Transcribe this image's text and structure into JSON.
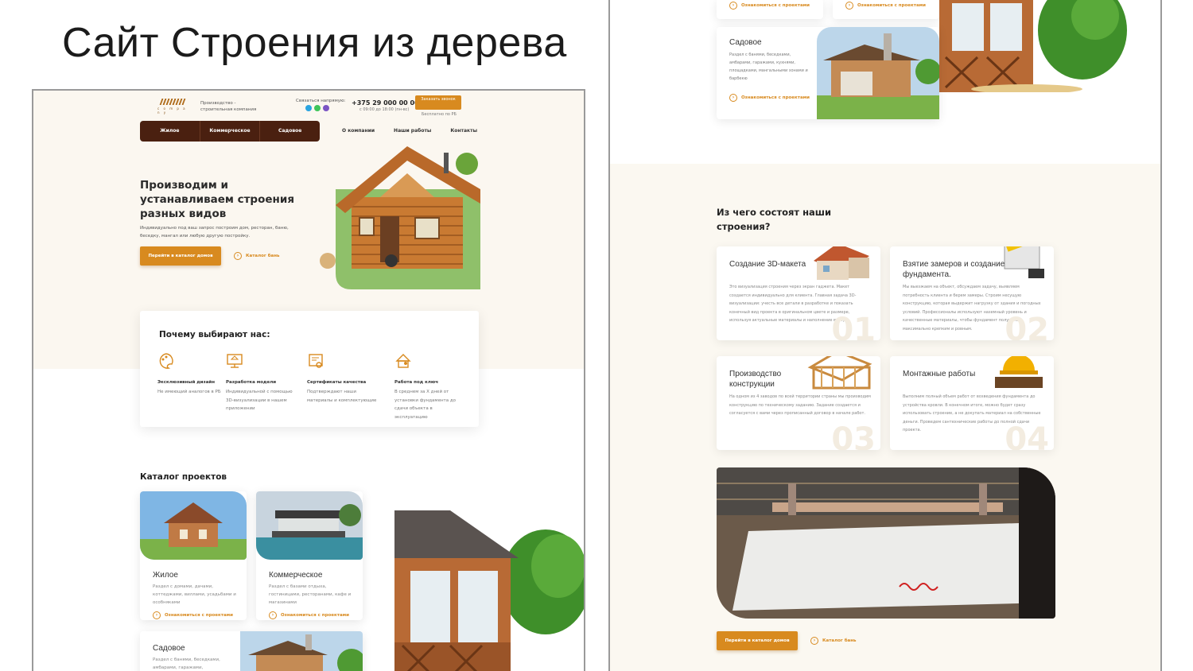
{
  "slide": {
    "title": "Сайт Строения из дерева"
  },
  "colors": {
    "accent": "#d88a1f",
    "nav_dark": "#4a2010",
    "cream": "#fbf7f0"
  },
  "left": {
    "header": {
      "logo_word": "c o m p a n y",
      "tagline": "Производство - строительная компания",
      "contact_label": "Связаться напрямую:",
      "phone": "+375 29 000 00 00",
      "hours": "с 09:00 до 18:00 (пн-вс)",
      "call_button": "Заказать звонок",
      "call_note": "Бесплатно по РБ"
    },
    "nav": {
      "dark_items": [
        "Жилое",
        "Коммерческое",
        "Садовое"
      ],
      "light_items": [
        "О компании",
        "Наши работы",
        "Контакты"
      ]
    },
    "hero": {
      "heading": "Производим и устанавливаем строения разных видов",
      "text": "Индивидуально под ваш запрос построим дом, ресторан, баню, беседку, мангал или любую другую постройку.",
      "button": "Перейти в каталог домов",
      "link": "Каталог бань"
    },
    "why": {
      "title": "Почему выбирают нас:",
      "items": [
        {
          "icon": "palette-icon",
          "title": "Эксклюзивный дизайн",
          "text": "Не имеющий аналогов в РБ"
        },
        {
          "icon": "monitor-model-icon",
          "title": "Разработка модели",
          "text": "Индивидуальной с помощью 3D-визуализации в нашем приложении"
        },
        {
          "icon": "certificate-icon",
          "title": "Сертификаты качества",
          "text": "Подтверждают наши материалы и комплектующие"
        },
        {
          "icon": "key-house-icon",
          "title": "Работа под ключ",
          "text": "В среднем за Х дней от установки фундамента до сдачи объекта в эксплуатацию"
        }
      ]
    },
    "catalog": {
      "title": "Каталог проектов",
      "cards": [
        {
          "name": "Жилое",
          "desc": "Раздел с домами, дачами, коттеджами, виллами, усадьбами и особняками",
          "link": "Ознакомиться с проектами"
        },
        {
          "name": "Коммерческое",
          "desc": "Раздел с базами отдыха, гостиницами, ресторанами, кафе и магазинами",
          "link": "Ознакомиться с проектами"
        },
        {
          "name": "Садовое",
          "desc": "Раздел с банями, беседками, амбарами, гаражами,",
          "link": "Ознакомиться с проектами"
        }
      ]
    }
  },
  "right": {
    "top_cards": [
      {
        "link": "Ознакомиться с проектами"
      },
      {
        "link": "Ознакомиться с проектами"
      }
    ],
    "garden_card": {
      "name": "Садовое",
      "desc": "Раздел с банями, беседками, амбарами, гаражами, кухнями, площадками, мангальными зонами и барбекю",
      "link": "Ознакомиться с проектами"
    },
    "steps": {
      "title": "Из чего состоят наши строения?",
      "items": [
        {
          "title": "Создание 3D-макета",
          "text": "Это визуализация строения через экран гаджета. Макет создается индивидуально для клиента. Главная задача 3D-визуализации: учесть все детали в разработке и показать конечный вид проекта в оригинальном цвете и размере, используя актуальные материалы и наполнение внутри.",
          "num": "01"
        },
        {
          "title": "Взятие замеров и создание фундамента.",
          "text": "Мы выезжаем на объект, обсуждаем задачу, выявляем потребность клиента и берем замеры. Строим несущую конструкцию, которая выдержит нагрузку от здания и погодных условий. Профессионалы используют наземный уровень и качественные материалы, чтобы фундамент получился максимально крепким и ровным.",
          "num": "02"
        },
        {
          "title": "Производство конструкции",
          "text": "На одном из 4 заводов по всей территории страны мы производим конструкцию по техническому заданию. Задание создается и согласуется с вами через прописанный договор в начале работ.",
          "num": "03"
        },
        {
          "title": "Монтажные работы",
          "text": "Выполним полный объем работ от возведения фундамента до устройства кровли. В конечном итоге, можно будет сразу использовать строение, а не докупать материал на собственные деньги. Проведем сантехнические работы до полной сдачи проекта.",
          "num": "04"
        }
      ]
    },
    "button": "Перейти в каталог домов",
    "link": "Каталог бань"
  }
}
